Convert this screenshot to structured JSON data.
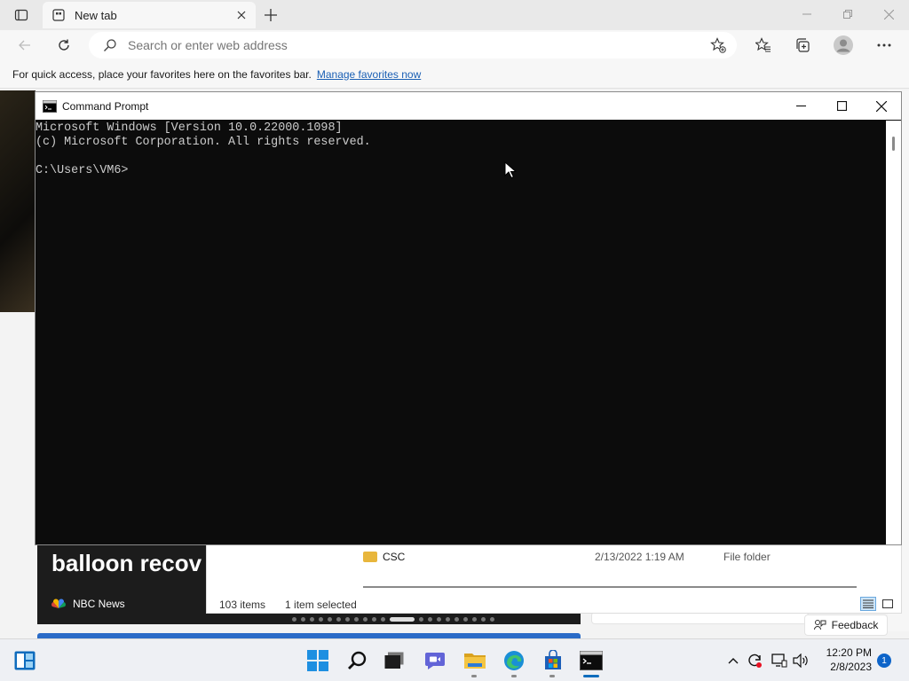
{
  "browser": {
    "tab_title": "New tab",
    "address_placeholder": "Search or enter web address",
    "favbar_text": "For quick access, place your favorites here on the favorites bar.",
    "favbar_link": "Manage favorites now",
    "icons": [
      "tab-actions-icon",
      "page-icon",
      "close-icon",
      "plus-icon",
      "minimize-icon",
      "restore-icon",
      "close-icon",
      "back-icon",
      "refresh-icon",
      "search-icon",
      "add-favorite-icon",
      "favorites-icon",
      "collections-icon",
      "profile-icon",
      "more-icon"
    ]
  },
  "background": {
    "news_headline": "balloon recov",
    "news_source": "NBC News",
    "feedback_label": "Feedback"
  },
  "explorer": {
    "row_name": "CSC",
    "row_date": "2/13/2022 1:19 AM",
    "row_type": "File folder",
    "items_count": "103 items",
    "selection": "1 item selected"
  },
  "cmd": {
    "title": "Command Prompt",
    "lines": [
      "Microsoft Windows [Version 10.0.22000.1098]",
      "(c) Microsoft Corporation. All rights reserved.",
      "",
      "C:\\Users\\VM6>"
    ],
    "colors": {
      "background": "#0c0c0c",
      "text": "#cccccc"
    }
  },
  "taskbar": {
    "apps": [
      "widgets-icon",
      "start-icon",
      "search-icon",
      "task-view-icon",
      "chat-icon",
      "file-explorer-icon",
      "edge-icon",
      "store-icon",
      "terminal-icon"
    ],
    "time": "12:20 PM",
    "date": "2/8/2023",
    "notification_count": "1"
  }
}
